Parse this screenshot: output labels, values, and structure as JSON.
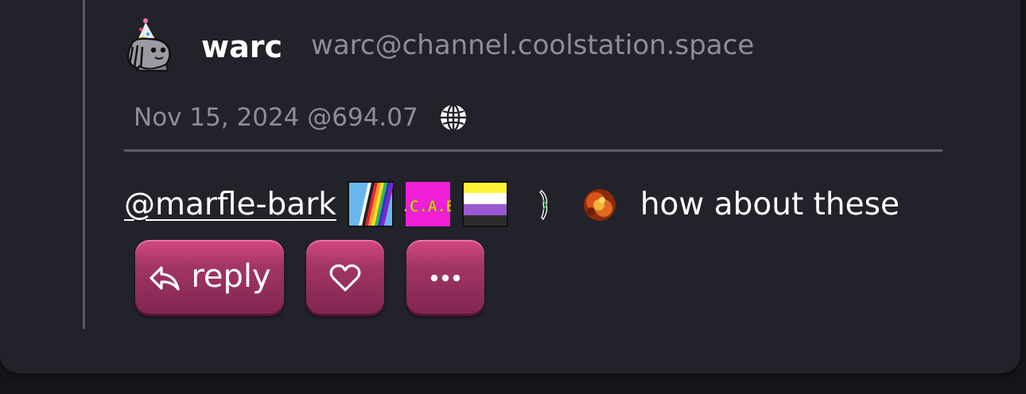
{
  "post": {
    "author": {
      "display_name": "warc",
      "handle": "warc@channel.coolstation.space",
      "avatar_icon": "avatar-party-hat"
    },
    "timestamp": "Nov 15, 2024 @694.07",
    "visibility_icon": "globe-icon",
    "content": {
      "mention": "@marfle-bark",
      "emojis": [
        "rainbow-flag-emoji",
        "acab-emoji",
        "nonbinary-flag-emoji",
        "bird-emoji",
        "explosion-emoji"
      ],
      "text": "how about these"
    },
    "actions": {
      "reply_label": "reply",
      "reply_icon": "reply-arrow-icon",
      "favorite_icon": "heart-icon",
      "more_icon": "ellipsis-icon"
    }
  },
  "colors": {
    "background": "#22222a",
    "text": "#ffffff",
    "muted": "#8e8e96",
    "accent": "#b23a6d"
  }
}
